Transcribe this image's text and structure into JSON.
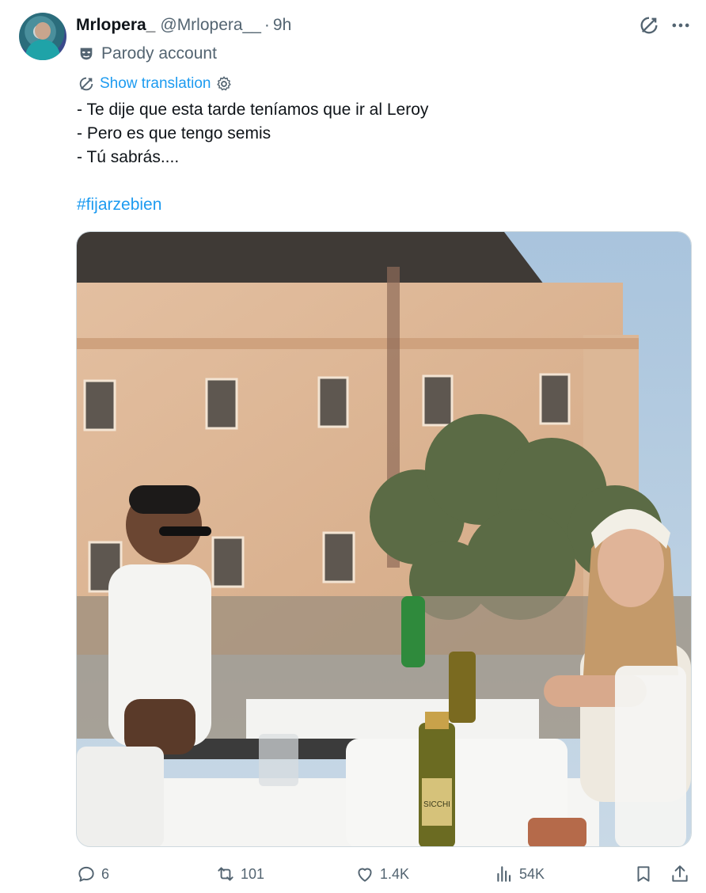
{
  "author": {
    "display_name": "Mrlopera_",
    "handle": "@Mrlopera__",
    "separator": "·",
    "time": "9h",
    "label": "Parody account"
  },
  "translate": {
    "label": "Show translation"
  },
  "tweet": {
    "lines": [
      "- Te dije que esta tarde teníamos que ir al Leroy",
      "- Pero es que tengo semis",
      "- Tú sabrás...."
    ],
    "hashtag": "#fijarzebien"
  },
  "media": {
    "bottle_label": "SICCHI"
  },
  "actions": {
    "replies": "6",
    "reposts": "101",
    "likes": "1.4K",
    "views": "54K"
  },
  "colors": {
    "accent": "#1d9bf0",
    "secondary_text": "#536471",
    "primary_text": "#0f1419"
  },
  "icons": {
    "grok": "grok-icon",
    "more": "more-icon",
    "parody": "theater-mask-icon",
    "translate": "translate-icon",
    "settings": "gear-icon",
    "reply": "reply-icon",
    "repost": "repost-icon",
    "like": "heart-icon",
    "views": "views-icon",
    "bookmark": "bookmark-icon",
    "share": "share-icon"
  }
}
